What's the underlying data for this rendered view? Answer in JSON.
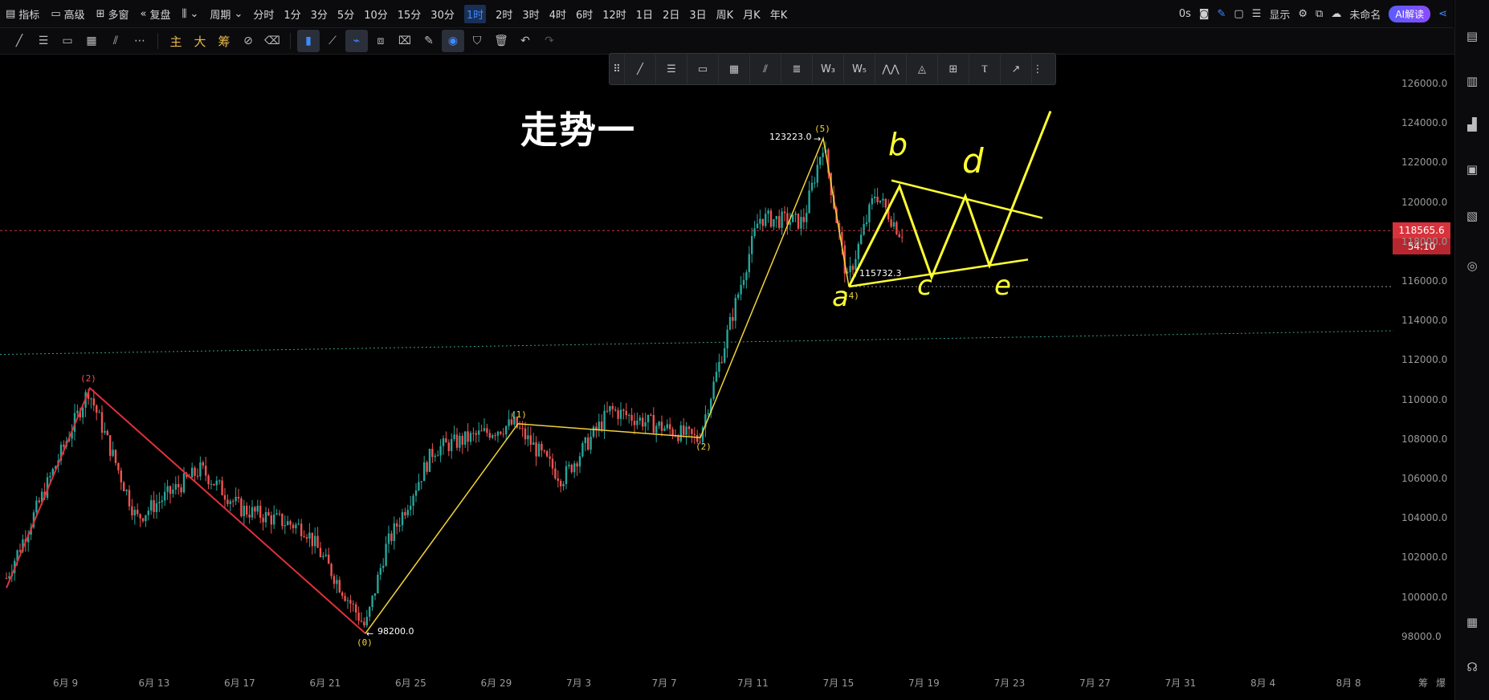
{
  "topbar": {
    "indicator": "指标",
    "advanced": "高级",
    "multi_window": "多窗",
    "replay": "复盘",
    "period": "周期",
    "intervals": [
      "分时",
      "1分",
      "3分",
      "5分",
      "10分",
      "15分",
      "30分",
      "1时",
      "2时",
      "3时",
      "4时",
      "6时",
      "12时",
      "1日",
      "2日",
      "3日",
      "周K",
      "月K",
      "年K"
    ],
    "active_interval": "1时",
    "latency": "0s",
    "display": "显示",
    "workspace": "未命名",
    "ai_label": "AI解读"
  },
  "toolbar": {
    "main": "主",
    "big": "大",
    "chip": "筹"
  },
  "chart": {
    "title": "走势一",
    "y_labels": [
      "126000.0",
      "124000.0",
      "122000.0",
      "120000.0",
      "118000.0",
      "116000.0",
      "114000.0",
      "112000.0",
      "110000.0",
      "108000.0",
      "106000.0",
      "104000.0",
      "102000.0",
      "100000.0",
      "98000.0"
    ],
    "x_labels": [
      "6月 9",
      "6月 13",
      "6月 17",
      "6月 21",
      "6月 25",
      "6月 29",
      "7月 3",
      "7月 7",
      "7月 11",
      "7月 15",
      "7月 19",
      "7月 23",
      "7月 27",
      "7月 31",
      "8月 4",
      "8月 8"
    ],
    "last_price": "118565.6",
    "countdown": "54:10",
    "high_label": "123223.0",
    "low_label": "98200.0",
    "mid_low_label": "115732.3",
    "wave_labels_red": [
      "(2)"
    ],
    "wave_labels_yellow": [
      "(1)",
      "(2)",
      "(5)",
      "(4)",
      "(0)"
    ],
    "handwritten": [
      "a",
      "b",
      "c",
      "d",
      "e"
    ],
    "corner_labels": [
      "筹",
      "爆"
    ],
    "colors": {
      "up": "#26a69a",
      "down": "#ef5350",
      "impulse": "#f2d43a",
      "corrective": "#e0303a",
      "handwriting": "#ffff33",
      "last_price": "#d8323b"
    }
  },
  "chart_data": {
    "type": "line",
    "title": "走势一",
    "xlabel": "",
    "ylabel": "",
    "ylim": [
      97000,
      127000
    ],
    "x": [
      "6月 9",
      "6月 13",
      "6月 17",
      "6月 21",
      "6月 25",
      "6月 29",
      "7月 3",
      "7月 7",
      "7月 11",
      "7月 15",
      "7月 19",
      "7月 23"
    ],
    "series": [
      {
        "values": [
          100500,
          110600,
          105500,
          104500,
          98200,
          108800,
          108100,
          116500,
          123223,
          115732,
          120800,
          116200
        ]
      }
    ],
    "annotations": [
      {
        "text": "123223.0",
        "value": 123223
      },
      {
        "text": "98200.0",
        "value": 98200
      },
      {
        "text": "115732.3",
        "value": 115732.3
      },
      {
        "text": "118565.6",
        "value": 118565.6
      }
    ],
    "grid": false
  }
}
